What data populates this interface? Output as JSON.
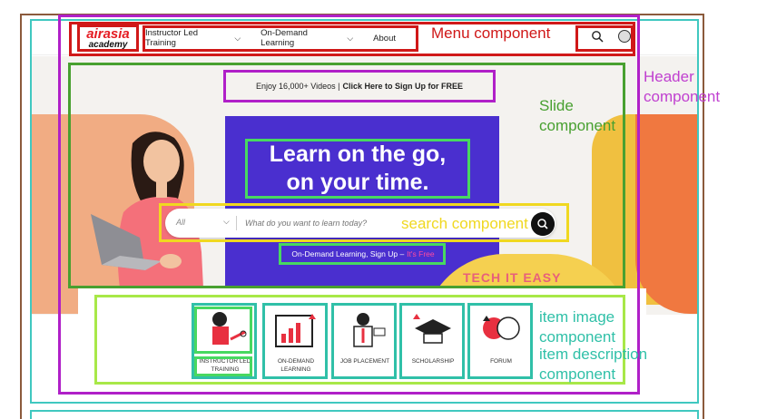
{
  "header": {
    "logo_top": "airasia",
    "logo_bottom": "academy",
    "nav": [
      {
        "label": "Instructor Led Training",
        "chevron": true
      },
      {
        "label": "On-Demand Learning",
        "chevron": true
      },
      {
        "label": "About",
        "chevron": false
      }
    ]
  },
  "promo": {
    "text": "Enjoy 16,000+ Videos |",
    "link": "Click Here to Sign Up for FREE"
  },
  "hero": {
    "headline_line1": "Learn on the go,",
    "headline_line2": "on your time.",
    "badge": "TECH IT EASY"
  },
  "search": {
    "category": "All",
    "placeholder": "What do you want to learn today?"
  },
  "sub_line": {
    "text": "On-Demand Learning, Sign Up –",
    "highlight": "It's Free"
  },
  "items": [
    {
      "label": "INSTRUCTOR LED TRAINING",
      "icon": "instructor-icon"
    },
    {
      "label": "ON-DEMAND LEARNING",
      "icon": "chart-icon"
    },
    {
      "label": "JOB PLACEMENT",
      "icon": "job-icon"
    },
    {
      "label": "SCHOLARSHIP",
      "icon": "graduation-cap-icon"
    },
    {
      "label": "FORUM",
      "icon": "forum-icon"
    }
  ],
  "annotations": {
    "menu": "Menu component",
    "header_l1": "Header",
    "header_l2": "component",
    "slide_l1": "Slide",
    "slide_l2": "component",
    "search": "search component",
    "item_image_l1": "item image",
    "item_image_l2": "component",
    "item_desc_l1": "item description",
    "item_desc_l2": "component"
  },
  "colors": {
    "brand_red": "#e51c23",
    "hero_purple": "#4a2fcf",
    "annotation_red": "#d01818",
    "annotation_purple": "#b020c8",
    "annotation_green": "#48a030",
    "annotation_yellow": "#f0d820",
    "annotation_teal": "#30c0a8"
  }
}
